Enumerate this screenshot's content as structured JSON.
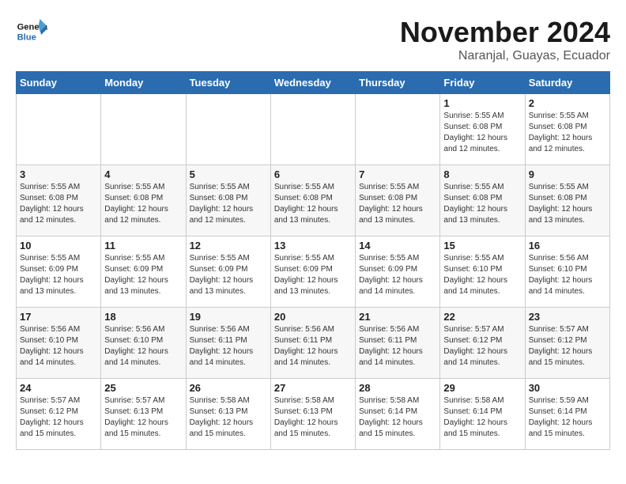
{
  "logo": {
    "line1": "General",
    "line2": "Blue"
  },
  "title": "November 2024",
  "location": "Naranjal, Guayas, Ecuador",
  "weekdays": [
    "Sunday",
    "Monday",
    "Tuesday",
    "Wednesday",
    "Thursday",
    "Friday",
    "Saturday"
  ],
  "weeks": [
    [
      {
        "day": "",
        "info": ""
      },
      {
        "day": "",
        "info": ""
      },
      {
        "day": "",
        "info": ""
      },
      {
        "day": "",
        "info": ""
      },
      {
        "day": "",
        "info": ""
      },
      {
        "day": "1",
        "info": "Sunrise: 5:55 AM\nSunset: 6:08 PM\nDaylight: 12 hours\nand 12 minutes."
      },
      {
        "day": "2",
        "info": "Sunrise: 5:55 AM\nSunset: 6:08 PM\nDaylight: 12 hours\nand 12 minutes."
      }
    ],
    [
      {
        "day": "3",
        "info": "Sunrise: 5:55 AM\nSunset: 6:08 PM\nDaylight: 12 hours\nand 12 minutes."
      },
      {
        "day": "4",
        "info": "Sunrise: 5:55 AM\nSunset: 6:08 PM\nDaylight: 12 hours\nand 12 minutes."
      },
      {
        "day": "5",
        "info": "Sunrise: 5:55 AM\nSunset: 6:08 PM\nDaylight: 12 hours\nand 12 minutes."
      },
      {
        "day": "6",
        "info": "Sunrise: 5:55 AM\nSunset: 6:08 PM\nDaylight: 12 hours\nand 13 minutes."
      },
      {
        "day": "7",
        "info": "Sunrise: 5:55 AM\nSunset: 6:08 PM\nDaylight: 12 hours\nand 13 minutes."
      },
      {
        "day": "8",
        "info": "Sunrise: 5:55 AM\nSunset: 6:08 PM\nDaylight: 12 hours\nand 13 minutes."
      },
      {
        "day": "9",
        "info": "Sunrise: 5:55 AM\nSunset: 6:08 PM\nDaylight: 12 hours\nand 13 minutes."
      }
    ],
    [
      {
        "day": "10",
        "info": "Sunrise: 5:55 AM\nSunset: 6:09 PM\nDaylight: 12 hours\nand 13 minutes."
      },
      {
        "day": "11",
        "info": "Sunrise: 5:55 AM\nSunset: 6:09 PM\nDaylight: 12 hours\nand 13 minutes."
      },
      {
        "day": "12",
        "info": "Sunrise: 5:55 AM\nSunset: 6:09 PM\nDaylight: 12 hours\nand 13 minutes."
      },
      {
        "day": "13",
        "info": "Sunrise: 5:55 AM\nSunset: 6:09 PM\nDaylight: 12 hours\nand 13 minutes."
      },
      {
        "day": "14",
        "info": "Sunrise: 5:55 AM\nSunset: 6:09 PM\nDaylight: 12 hours\nand 14 minutes."
      },
      {
        "day": "15",
        "info": "Sunrise: 5:55 AM\nSunset: 6:10 PM\nDaylight: 12 hours\nand 14 minutes."
      },
      {
        "day": "16",
        "info": "Sunrise: 5:56 AM\nSunset: 6:10 PM\nDaylight: 12 hours\nand 14 minutes."
      }
    ],
    [
      {
        "day": "17",
        "info": "Sunrise: 5:56 AM\nSunset: 6:10 PM\nDaylight: 12 hours\nand 14 minutes."
      },
      {
        "day": "18",
        "info": "Sunrise: 5:56 AM\nSunset: 6:10 PM\nDaylight: 12 hours\nand 14 minutes."
      },
      {
        "day": "19",
        "info": "Sunrise: 5:56 AM\nSunset: 6:11 PM\nDaylight: 12 hours\nand 14 minutes."
      },
      {
        "day": "20",
        "info": "Sunrise: 5:56 AM\nSunset: 6:11 PM\nDaylight: 12 hours\nand 14 minutes."
      },
      {
        "day": "21",
        "info": "Sunrise: 5:56 AM\nSunset: 6:11 PM\nDaylight: 12 hours\nand 14 minutes."
      },
      {
        "day": "22",
        "info": "Sunrise: 5:57 AM\nSunset: 6:12 PM\nDaylight: 12 hours\nand 14 minutes."
      },
      {
        "day": "23",
        "info": "Sunrise: 5:57 AM\nSunset: 6:12 PM\nDaylight: 12 hours\nand 15 minutes."
      }
    ],
    [
      {
        "day": "24",
        "info": "Sunrise: 5:57 AM\nSunset: 6:12 PM\nDaylight: 12 hours\nand 15 minutes."
      },
      {
        "day": "25",
        "info": "Sunrise: 5:57 AM\nSunset: 6:13 PM\nDaylight: 12 hours\nand 15 minutes."
      },
      {
        "day": "26",
        "info": "Sunrise: 5:58 AM\nSunset: 6:13 PM\nDaylight: 12 hours\nand 15 minutes."
      },
      {
        "day": "27",
        "info": "Sunrise: 5:58 AM\nSunset: 6:13 PM\nDaylight: 12 hours\nand 15 minutes."
      },
      {
        "day": "28",
        "info": "Sunrise: 5:58 AM\nSunset: 6:14 PM\nDaylight: 12 hours\nand 15 minutes."
      },
      {
        "day": "29",
        "info": "Sunrise: 5:58 AM\nSunset: 6:14 PM\nDaylight: 12 hours\nand 15 minutes."
      },
      {
        "day": "30",
        "info": "Sunrise: 5:59 AM\nSunset: 6:14 PM\nDaylight: 12 hours\nand 15 minutes."
      }
    ]
  ]
}
